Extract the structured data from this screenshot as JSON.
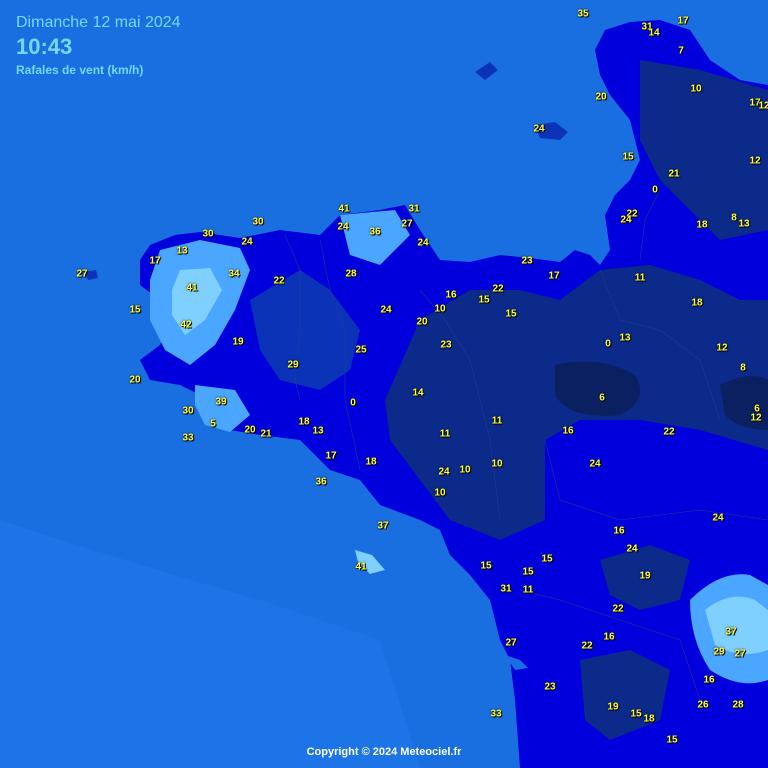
{
  "header": {
    "date": "Dimanche 12 mai 2024",
    "time": "10:43",
    "subtitle": "Rafales de vent (km/h)"
  },
  "footer": {
    "copyright": "Copyright © 2024 Meteociel.fr"
  },
  "colors": {
    "sea": "#1a6fe0",
    "land_strong": "#0000e0",
    "land_medium": "#0a33b8",
    "land_calm": "#0b2a8a",
    "land_very_calm": "#0a2060",
    "gust_light": "#4aa6ff",
    "gust_strong": "#7fd0ff",
    "label": "#ffff3a",
    "header_text": "#7ad6ff"
  },
  "stations": [
    {
      "value": "35"
    },
    {
      "value": "31"
    },
    {
      "value": "14"
    },
    {
      "value": "17"
    },
    {
      "value": "7"
    },
    {
      "value": "20"
    },
    {
      "value": "10"
    },
    {
      "value": "17"
    },
    {
      "value": "12"
    },
    {
      "value": "24"
    },
    {
      "value": "15"
    },
    {
      "value": "12"
    },
    {
      "value": "21"
    },
    {
      "value": "0"
    },
    {
      "value": "22"
    },
    {
      "value": "24"
    },
    {
      "value": "18"
    },
    {
      "value": "8"
    },
    {
      "value": "13"
    },
    {
      "value": "41"
    },
    {
      "value": "31"
    },
    {
      "value": "30"
    },
    {
      "value": "24"
    },
    {
      "value": "36"
    },
    {
      "value": "27"
    },
    {
      "value": "30"
    },
    {
      "value": "24"
    },
    {
      "value": "24"
    },
    {
      "value": "13"
    },
    {
      "value": "17"
    },
    {
      "value": "27"
    },
    {
      "value": "34"
    },
    {
      "value": "22"
    },
    {
      "value": "28"
    },
    {
      "value": "23"
    },
    {
      "value": "17"
    },
    {
      "value": "11"
    },
    {
      "value": "41"
    },
    {
      "value": "16"
    },
    {
      "value": "15"
    },
    {
      "value": "22"
    },
    {
      "value": "15"
    },
    {
      "value": "18"
    },
    {
      "value": "42"
    },
    {
      "value": "24"
    },
    {
      "value": "10"
    },
    {
      "value": "20"
    },
    {
      "value": "15"
    },
    {
      "value": "19"
    },
    {
      "value": "25"
    },
    {
      "value": "23"
    },
    {
      "value": "0"
    },
    {
      "value": "13"
    },
    {
      "value": "12"
    },
    {
      "value": "29"
    },
    {
      "value": "20"
    },
    {
      "value": "8"
    },
    {
      "value": "14"
    },
    {
      "value": "39"
    },
    {
      "value": "6"
    },
    {
      "value": "30"
    },
    {
      "value": "0"
    },
    {
      "value": "6"
    },
    {
      "value": "12"
    },
    {
      "value": "5"
    },
    {
      "value": "18"
    },
    {
      "value": "11"
    },
    {
      "value": "33"
    },
    {
      "value": "20"
    },
    {
      "value": "21"
    },
    {
      "value": "13"
    },
    {
      "value": "11"
    },
    {
      "value": "16"
    },
    {
      "value": "22"
    },
    {
      "value": "17"
    },
    {
      "value": "18"
    },
    {
      "value": "24"
    },
    {
      "value": "10"
    },
    {
      "value": "10"
    },
    {
      "value": "24"
    },
    {
      "value": "36"
    },
    {
      "value": "10"
    },
    {
      "value": "24"
    },
    {
      "value": "37"
    },
    {
      "value": "16"
    },
    {
      "value": "24"
    },
    {
      "value": "15"
    },
    {
      "value": "41"
    },
    {
      "value": "15"
    },
    {
      "value": "15"
    },
    {
      "value": "19"
    },
    {
      "value": "31"
    },
    {
      "value": "11"
    },
    {
      "value": "22"
    },
    {
      "value": "16"
    },
    {
      "value": "37"
    },
    {
      "value": "27"
    },
    {
      "value": "22"
    },
    {
      "value": "29"
    },
    {
      "value": "27"
    },
    {
      "value": "16"
    },
    {
      "value": "23"
    },
    {
      "value": "26"
    },
    {
      "value": "28"
    },
    {
      "value": "33"
    },
    {
      "value": "19"
    },
    {
      "value": "15"
    },
    {
      "value": "18"
    },
    {
      "value": "15"
    }
  ]
}
